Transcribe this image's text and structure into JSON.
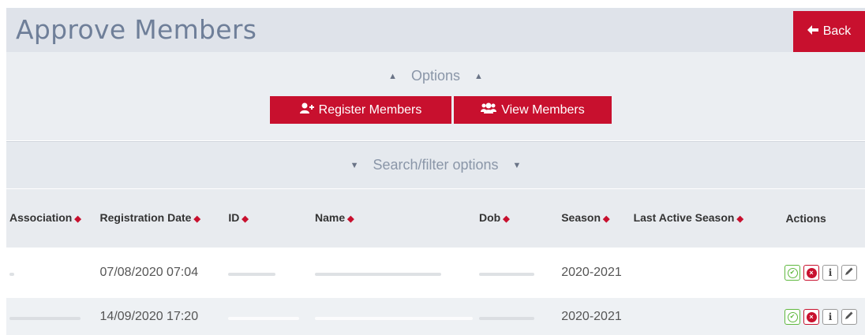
{
  "header": {
    "title": "Approve Members",
    "back_label": "Back",
    "back_icon": "arrow-left-icon",
    "accent": "#c8102e"
  },
  "options": {
    "title": "Options",
    "register_label": "Register Members",
    "register_icon": "user-plus-icon",
    "view_label": "View Members",
    "view_icon": "users-icon"
  },
  "search": {
    "title": "Search/filter options"
  },
  "table": {
    "columns": [
      {
        "label": "Association",
        "sortable": true
      },
      {
        "label": "Registration Date",
        "sortable": true
      },
      {
        "label": "ID",
        "sortable": true
      },
      {
        "label": "Name",
        "sortable": true
      },
      {
        "label": "Dob",
        "sortable": true
      },
      {
        "label": "Season",
        "sortable": true
      },
      {
        "label": "Last Active Season",
        "sortable": true
      },
      {
        "label": "Actions",
        "sortable": false
      }
    ],
    "rows": [
      {
        "registration_date": "07/08/2020 07:04",
        "season": "2020-2021"
      },
      {
        "registration_date": "14/09/2020 17:20",
        "season": "2020-2021"
      }
    ],
    "action_icons": [
      "approve-icon",
      "reject-icon",
      "info-icon",
      "edit-icon"
    ]
  }
}
